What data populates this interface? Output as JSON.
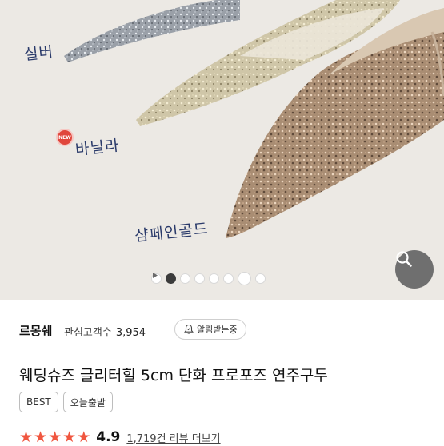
{
  "gallery": {
    "labels": {
      "silver": "실버",
      "vanilla": "바닐라",
      "champagne": "샴페인골드",
      "new_badge": "NEW"
    },
    "slide_index": 2,
    "slide_count": 8
  },
  "product": {
    "brand": "르몽쉐",
    "watchers_label": "관심고객수",
    "watchers_count": "3,954",
    "alert_label": "알림받는중",
    "title": "웨딩슈즈 글리터힐 5cm 단화 프로포즈 연주구두",
    "tags": [
      "BEST",
      "오늘출발"
    ],
    "rating": {
      "stars": 5,
      "score": "4.9",
      "reviews_text": "1,719건 리뷰 더보기"
    }
  },
  "colors": {
    "accent_star": "#f0563f",
    "hand_ink": "#2a3a6a",
    "new_badge": "#e0463c"
  },
  "icons": [
    "search-icon",
    "bell-icon",
    "play-icon",
    "star-icon"
  ]
}
